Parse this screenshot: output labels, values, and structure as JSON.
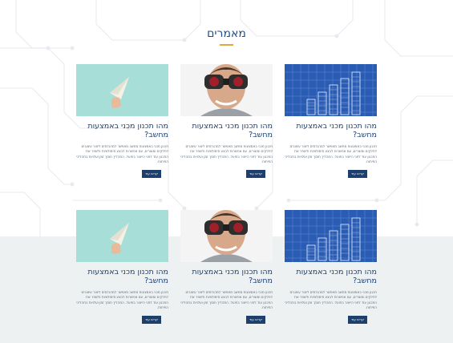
{
  "section": {
    "title": "מאמרים",
    "accent_color": "#e0a93a",
    "title_color": "#1f4e8a",
    "button_color": "#1c3f6e"
  },
  "cards": [
    {
      "image": "blueprint-building-image",
      "title": "מהו תכנון מכני באמצעות מחשב?",
      "desc": "תכנון מכני באמצעות מחשב מאפשר למהנדסים ליצור עיצובים לחלקים ומוצרים, עם אפשרות לבצע סימולציות ולשפר את התכנון עוד לפני הייצור בפועל. התהליך חוסך זמן ועלויות בתהליכי הפיתוח.",
      "button": "קראו עוד"
    },
    {
      "image": "man-with-binoculars-image",
      "title": "מהו תכנון מכני באמצעות מחשב?",
      "desc": "תכנון מכני באמצעות מחשב מאפשר למהנדסים ליצור עיצובים לחלקים ומוצרים, עם אפשרות לבצע סימולציות ולשפר את התכנון עוד לפני הייצור בפועל. התהליך חוסך זמן ועלויות בתהליכי הפיתוח.",
      "button": "קראו עוד"
    },
    {
      "image": "paper-plane-image",
      "title": "מהו תכנון מכני באמצעות מחשב?",
      "desc": "תכנון מכני באמצעות מחשב מאפשר למהנדסים ליצור עיצובים לחלקים ומוצרים, עם אפשרות לבצע סימולציות ולשפר את התכנון עוד לפני הייצור בפועל. התהליך חוסך זמן ועלויות בתהליכי הפיתוח.",
      "button": "קראו עוד"
    },
    {
      "image": "blueprint-building-image",
      "title": "מהו תכנון מכני באמצעות מחשב?",
      "desc": "תכנון מכני באמצעות מחשב מאפשר למהנדסים ליצור עיצובים לחלקים ומוצרים, עם אפשרות לבצע סימולציות ולשפר את התכנון עוד לפני הייצור בפועל. התהליך חוסך זמן ועלויות בתהליכי הפיתוח.",
      "button": "קראו עוד"
    },
    {
      "image": "man-with-binoculars-image",
      "title": "מהו תכנון מכני באמצעות מחשב?",
      "desc": "תכנון מכני באמצעות מחשב מאפשר למהנדסים ליצור עיצובים לחלקים ומוצרים, עם אפשרות לבצע סימולציות ולשפר את התכנון עוד לפני הייצור בפועל. התהליך חוסך זמן ועלויות בתהליכי הפיתוח.",
      "button": "קראו עוד"
    },
    {
      "image": "paper-plane-image",
      "title": "מהו תכנון מכני באמצעות מחשב?",
      "desc": "תכנון מכני באמצעות מחשב מאפשר למהנדסים ליצור עיצובים לחלקים ומוצרים, עם אפשרות לבצע סימולציות ולשפר את התכנון עוד לפני הייצור בפועל. התהליך חוסך זמן ועלויות בתהליכי הפיתוח.",
      "button": "קראו עוד"
    }
  ]
}
